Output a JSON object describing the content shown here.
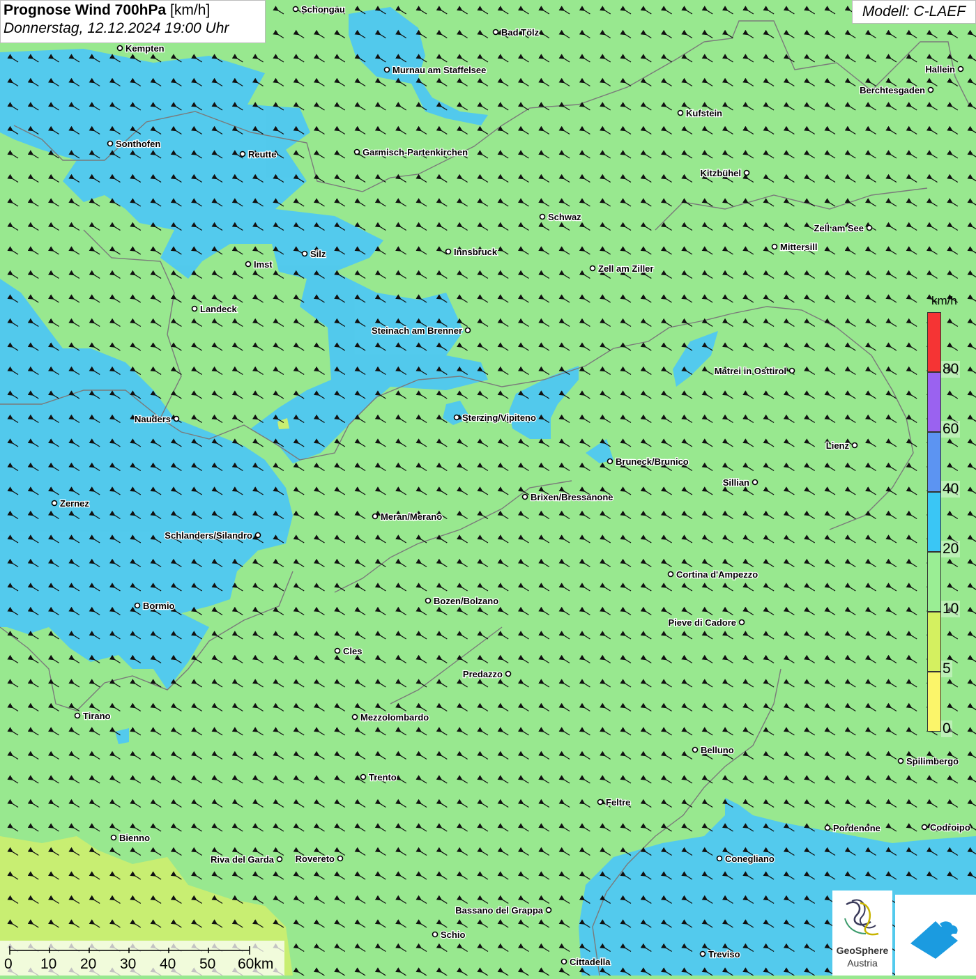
{
  "header": {
    "title_bold": "Prognose Wind 700hPa",
    "title_unit": " [km/h]",
    "datetime": "Donnerstag, 12.12.2024 19:00 Uhr",
    "model": "Modell: C-LAEF"
  },
  "legend": {
    "unit": "km/h",
    "classes": [
      {
        "label": "80",
        "color": "#f53434"
      },
      {
        "label": "60",
        "color": "#9a62f0"
      },
      {
        "label": "40",
        "color": "#5c94f2"
      },
      {
        "label": "20",
        "color": "#3ac6f5"
      },
      {
        "label": "10",
        "color": "#9aee94"
      },
      {
        "label": "5",
        "color": "#d4f060"
      },
      {
        "label": "0",
        "color": "#fbf56a"
      }
    ]
  },
  "scale": {
    "ticks": [
      "0",
      "10",
      "20",
      "30",
      "40",
      "50",
      "60km"
    ]
  },
  "logos": {
    "geosphere_line1": "GeoSphere",
    "geosphere_line2": "Austria"
  },
  "colors": {
    "calm_green": "#98e88f",
    "wind_blue": "#4fc8f2",
    "light_yellow_green": "#c8ee72",
    "arrow": "#111111",
    "border": "#7a7a7a"
  },
  "wind_direction": "northwest",
  "cities": [
    "Schongau",
    "Bad Tölz",
    "Kempten",
    "Murnau am Staffelsee",
    "Hallein",
    "Berchtesgaden",
    "Kufstein",
    "Sonthofen",
    "Reutte",
    "Garmisch-Partenkirchen",
    "Kitzbühel",
    "Schwaz",
    "Zell am See",
    "Mittersill",
    "Innsbruck",
    "Silz",
    "Imst",
    "Zell am Ziller",
    "Landeck",
    "Steinach am Brenner",
    "Matrei in Osttirol",
    "Nauders",
    "Sterzing/Vipiteno",
    "Lienz",
    "Bruneck/Brunico",
    "Sillian",
    "Brixen/Bressanone",
    "Zernez",
    "Meran/Merano",
    "Schlanders/Silandro",
    "Cortina d'Ampezzo",
    "Bozen/Bolzano",
    "Bormio",
    "Pieve di Cadore",
    "Cles",
    "Predazzo",
    "Tirano",
    "Mezzolombardo",
    "Belluno",
    "Spilimbergo",
    "Trento",
    "Feltre",
    "Bienno",
    "Pordenone",
    "Codroipo",
    "Riva del Garda",
    "Rovereto",
    "Conegliano",
    "Bassano del Grappa",
    "Schio",
    "Treviso",
    "Cittadella"
  ]
}
